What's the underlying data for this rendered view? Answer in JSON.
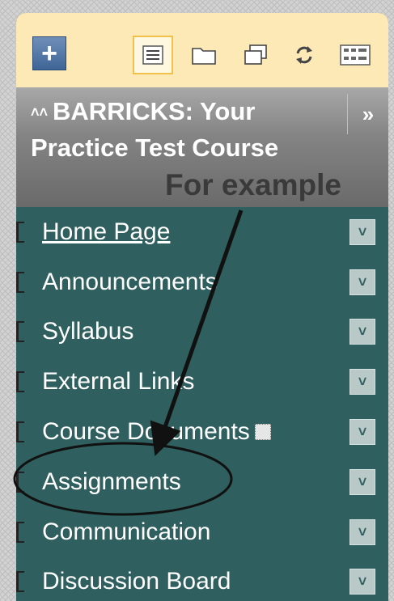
{
  "toolbar": {
    "add_label": "+",
    "icons": [
      "list-view-icon",
      "folder-icon",
      "window-icon",
      "refresh-icon",
      "detail-view-icon"
    ]
  },
  "course": {
    "title": "BARRICKS: Your Practice Test Course",
    "collapse_label": "»"
  },
  "annotation": "For example",
  "menu": {
    "items": [
      {
        "label": "Home Page"
      },
      {
        "label": "Announcements"
      },
      {
        "label": "Syllabus"
      },
      {
        "label": "External Links"
      },
      {
        "label": "Course Documents"
      },
      {
        "label": "Assignments"
      },
      {
        "label": "Communication"
      },
      {
        "label": "Discussion Board"
      }
    ]
  },
  "colors": {
    "toolbar_bg": "#fde9b6",
    "header_bg": "#848484",
    "menu_bg": "#2f5f5e",
    "add_button": "#4a6f9f",
    "annotation_text": "#3a3a3a"
  }
}
